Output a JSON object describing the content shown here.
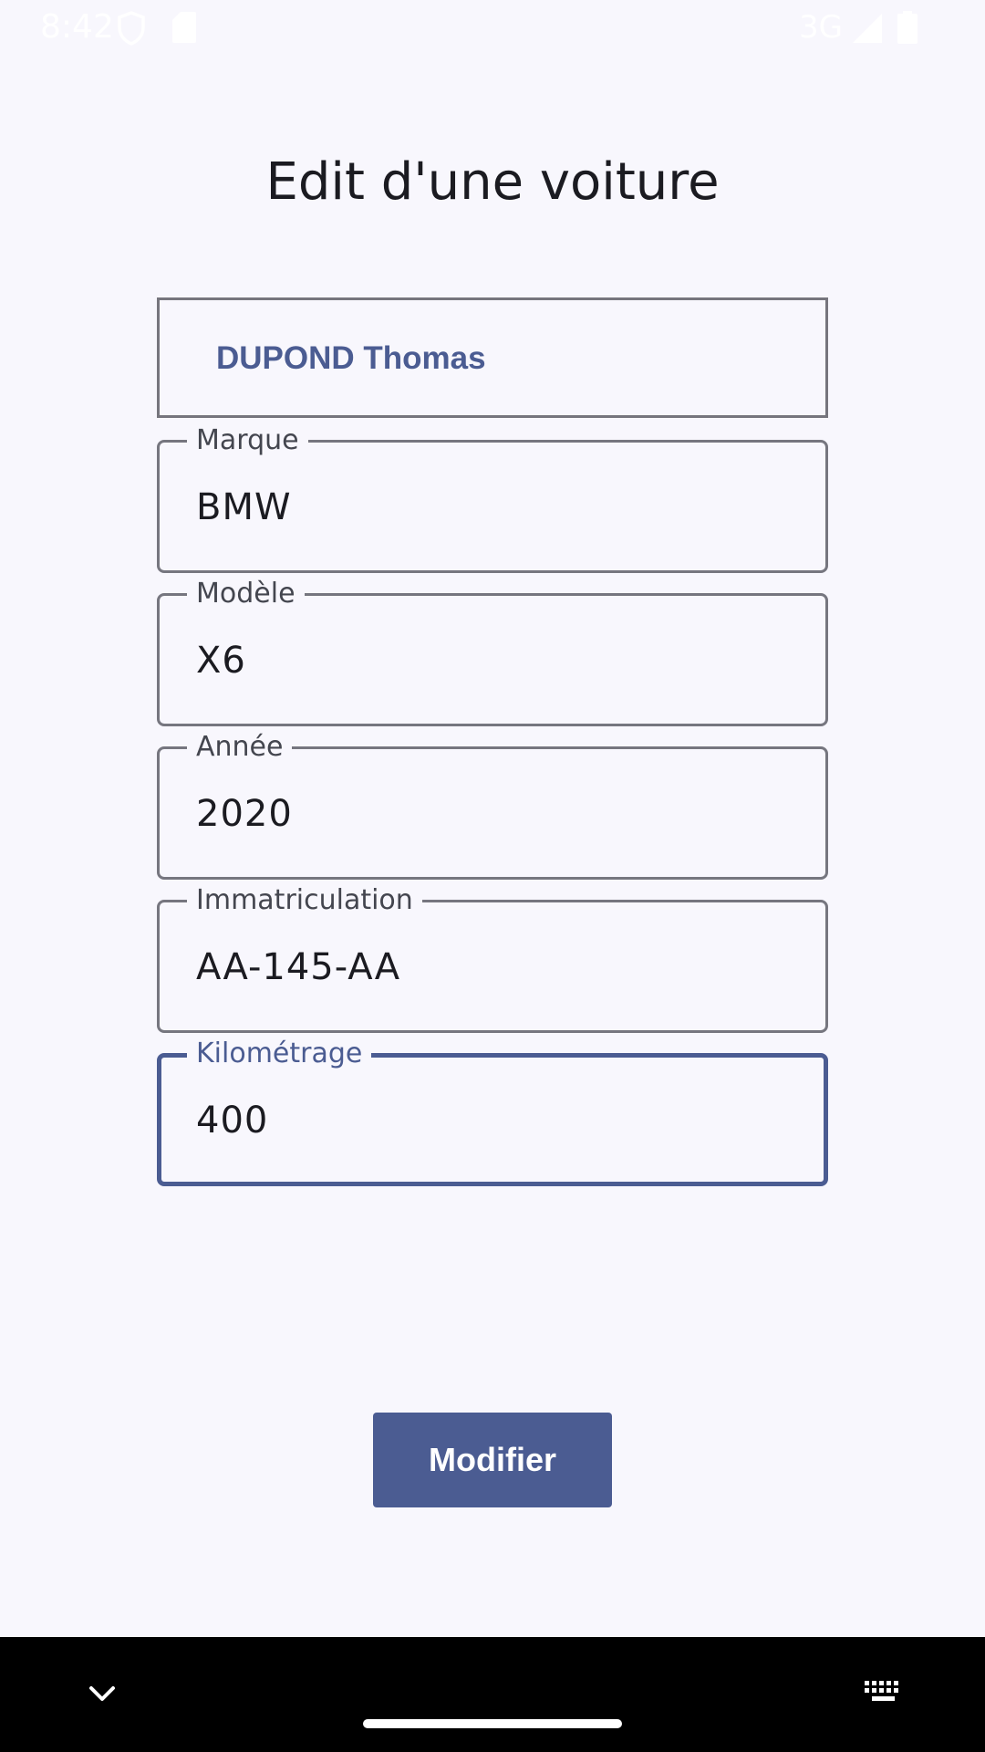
{
  "status_bar": {
    "time": "8:42",
    "network": "3G",
    "icons": [
      "shield-icon",
      "sim-card-icon",
      "signal-icon",
      "battery-icon"
    ]
  },
  "page": {
    "title": "Edit d'une voiture"
  },
  "owner": {
    "name": "DUPOND Thomas"
  },
  "fields": {
    "marque": {
      "label": "Marque",
      "value": "BMW"
    },
    "modele": {
      "label": "Modèle",
      "value": "X6"
    },
    "annee": {
      "label": "Année",
      "value": "2020"
    },
    "immatriculation": {
      "label": "Immatriculation",
      "value": "AA-145-AA"
    },
    "kilometrage": {
      "label": "Kilométrage",
      "value": "400"
    }
  },
  "actions": {
    "modify_label": "Modifier"
  },
  "colors": {
    "primary": "#4b5c92",
    "background": "#f8f7fd",
    "outline": "#76767f"
  },
  "nav_bar": {
    "icons": [
      "chevron-down-icon",
      "home-handle",
      "keyboard-icon"
    ]
  }
}
